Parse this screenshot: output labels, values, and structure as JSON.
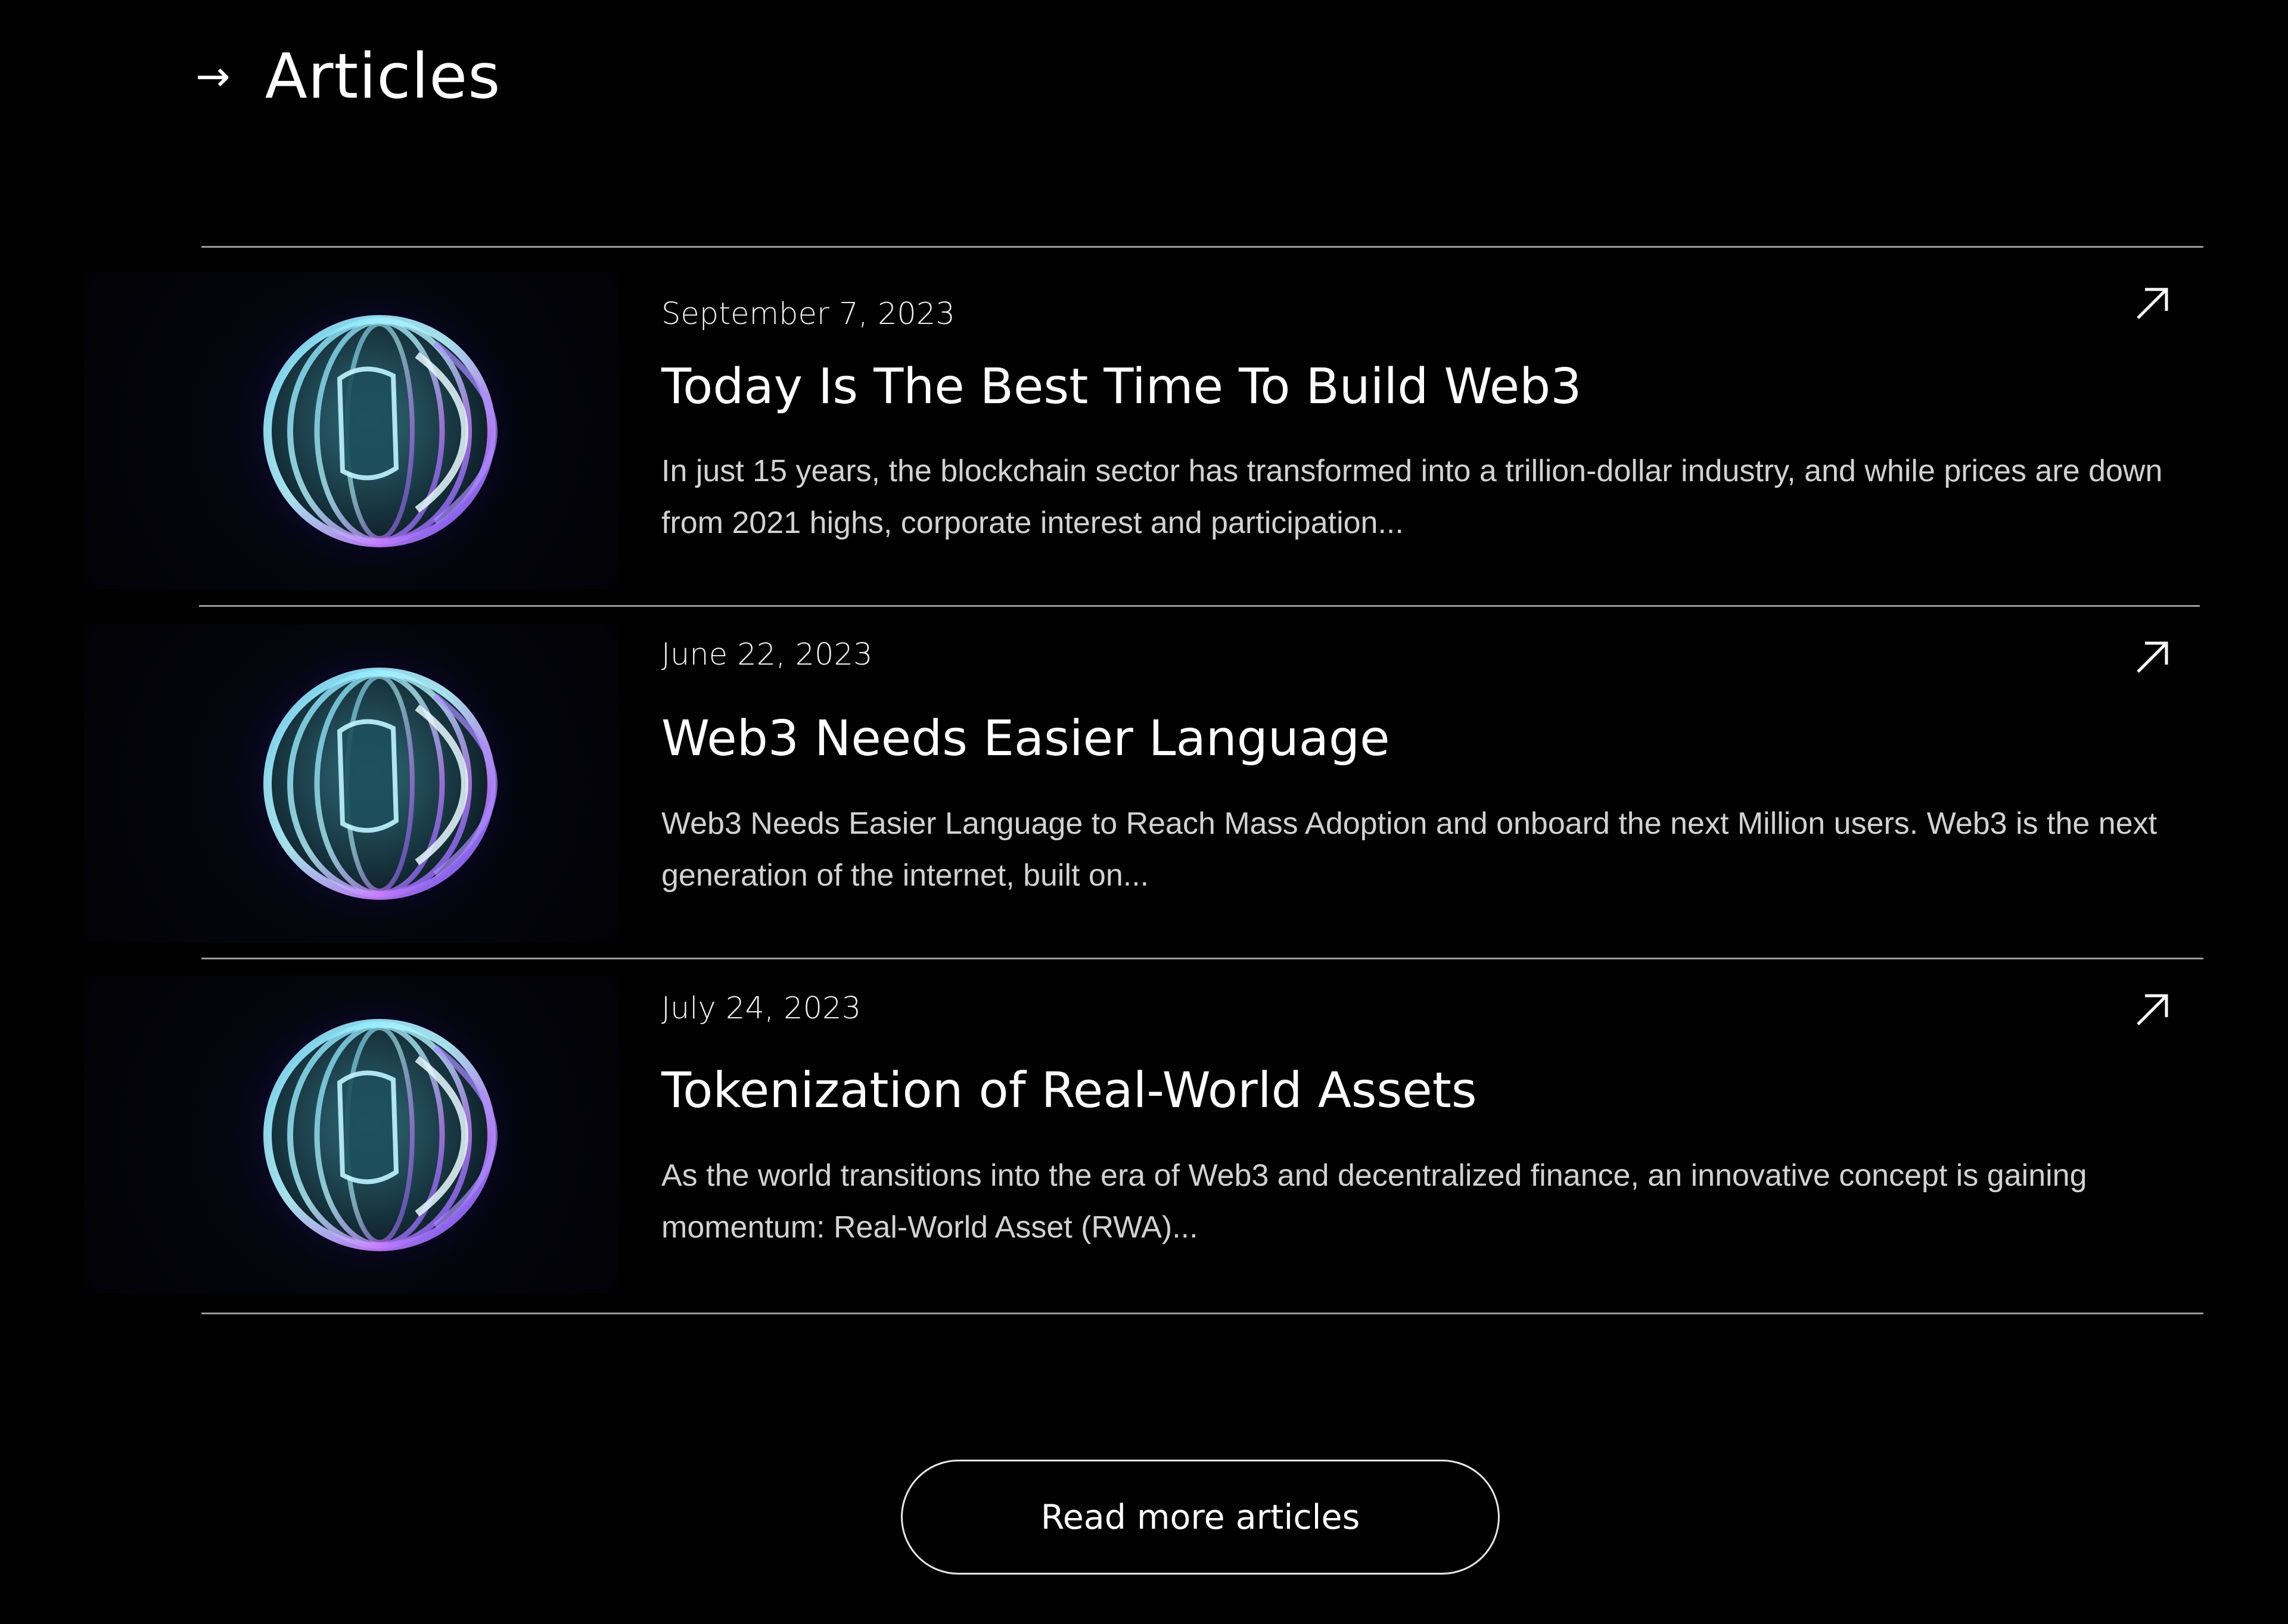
{
  "section": {
    "arrow_icon": "arrow-right-icon",
    "title": "Articles"
  },
  "articles": [
    {
      "date": "September 7, 2023",
      "title": "Today Is The Best Time To Build Web3",
      "excerpt": "In just 15 years, the blockchain sector has transformed into a trillion-dollar industry, and while prices are down from 2021 highs, corporate interest and participation...",
      "thumbnail_icon": "glass-sphere-image",
      "link_icon": "arrow-up-right-icon"
    },
    {
      "date": "June 22, 2023",
      "title": "Web3 Needs Easier Language",
      "excerpt": "Web3 Needs Easier Language to Reach Mass Adoption and onboard the next Million users. Web3 is the next generation of the internet, built on...",
      "thumbnail_icon": "glass-sphere-image",
      "link_icon": "arrow-up-right-icon"
    },
    {
      "date": "July 24, 2023",
      "title": "Tokenization of Real-World Assets",
      "excerpt": "As the world transitions into the era of Web3 and decentralized finance, an innovative concept is gaining momentum: Real-World Asset (RWA)...",
      "thumbnail_icon": "glass-sphere-image",
      "link_icon": "arrow-up-right-icon"
    }
  ],
  "read_more_label": "Read more articles",
  "colors": {
    "background": "#000000",
    "text": "#ffffff",
    "muted_text": "#d2d2d2",
    "divider": "#9a9a9a",
    "glow": "#5a3cff"
  }
}
